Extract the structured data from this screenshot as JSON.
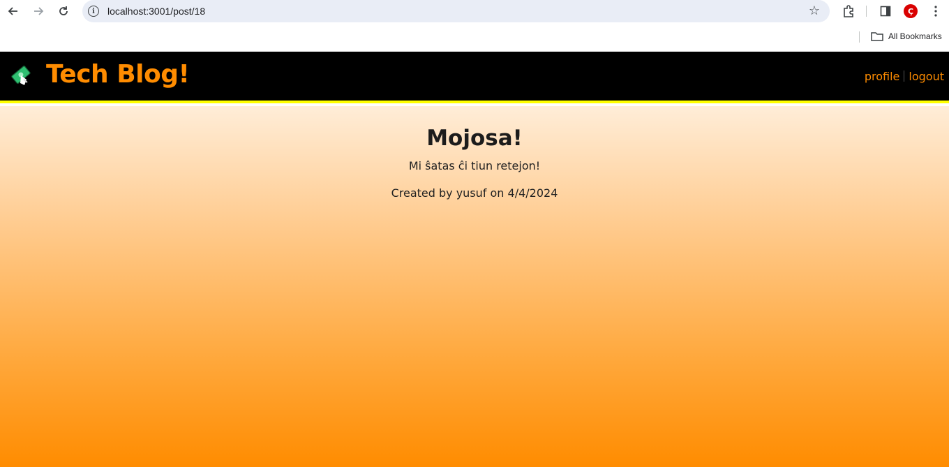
{
  "browser": {
    "url": "localhost:3001/post/18",
    "bookmarks_label": "All Bookmarks",
    "profile_initial": "Ç"
  },
  "site": {
    "title": "Tech Blog!",
    "nav": {
      "profile_label": "profile",
      "logout_label": "logout"
    }
  },
  "post": {
    "title": "Mojosa!",
    "body": "Mi ŝatas ĉi tiun retejon!",
    "meta": "Created by yusuf on 4/4/2024"
  },
  "colors": {
    "accent": "#ff8c00",
    "header_bg": "#000000",
    "header_border": "#ffff00"
  }
}
